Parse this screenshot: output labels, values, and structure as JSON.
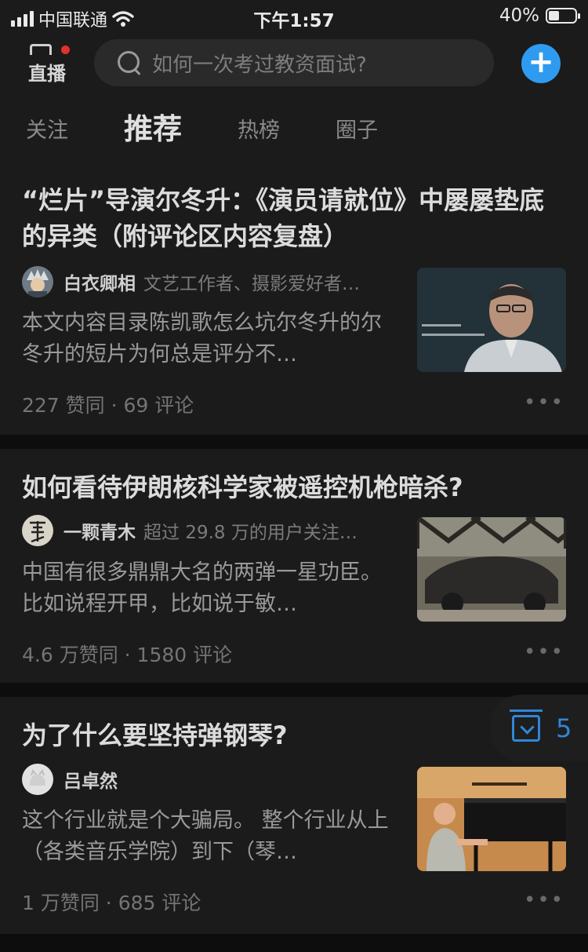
{
  "status_bar": {
    "carrier": "中国联通",
    "time": "下午1:57",
    "battery": "40%"
  },
  "header": {
    "live_label": "直播",
    "search_placeholder": "如何一次考过教资面试?"
  },
  "tabs": [
    {
      "label": "关注",
      "active": false
    },
    {
      "label": "推荐",
      "active": true
    },
    {
      "label": "热榜",
      "active": false
    },
    {
      "label": "圈子",
      "active": false
    }
  ],
  "feed": [
    {
      "title": "“烂片”导演尔冬升：《演员请就位》中屡屡垫底的异类（附评论区内容复盘）",
      "author": "白衣卿相",
      "author_desc": "文艺工作者、摄影爱好者…",
      "excerpt": "本文内容目录陈凯歌怎么坑尔冬升的尔冬升的短片为何总是评分不…",
      "stats": "227 赞同 · 69 评论",
      "more": "•••"
    },
    {
      "title": "如何看待伊朗核科学家被遥控机枪暗杀?",
      "author": "一颗青木",
      "author_desc": "超过 29.8 万的用户关注…",
      "excerpt": "中国有很多鼎鼎大名的两弹一星功臣。 比如说程开甲，比如说于敏…",
      "stats": "4.6 万赞同 · 1580 评论",
      "more": "•••"
    },
    {
      "title": "为了什么要坚持弹钢琴?",
      "author": "吕卓然",
      "author_desc": "",
      "excerpt": "这个行业就是个大骗局。 整个行业从上（各类音乐学院）到下（琴…",
      "stats": "1 万赞同 · 685 评论",
      "more": "•••"
    }
  ],
  "favorites": {
    "count": "5"
  }
}
